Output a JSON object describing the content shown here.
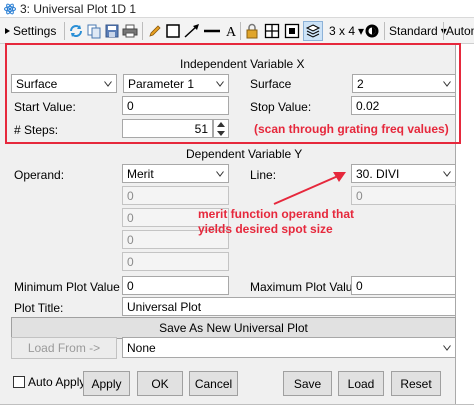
{
  "window": {
    "title": "3: Universal Plot 1D 1"
  },
  "toolbar": {
    "settings_label": "Settings",
    "layout_label": "3 x 4",
    "layout_arrow": "▾",
    "standard_label": "Standard",
    "standard_arrow": "▾",
    "auto_label": "Autom",
    "icons": [
      "refresh-icon",
      "copy-icon",
      "save-file-icon",
      "print-icon",
      "pencil-icon",
      "rectangle-icon",
      "arrow-line-icon",
      "line-icon",
      "text-a-icon",
      "lock-icon",
      "grid-layout-icon",
      "layers-icon",
      "contrast-icon"
    ]
  },
  "independent": {
    "header": "Independent Variable X",
    "surface_combo": "Surface",
    "parameter_combo": "Parameter 1",
    "surface_label": "Surface",
    "surface_value": "2",
    "start_label": "Start Value:",
    "start_value": "0",
    "stop_label": "Stop Value:",
    "stop_value": "0.02",
    "steps_label": "# Steps:",
    "steps_value": "51"
  },
  "dependent": {
    "header": "Dependent Variable Y",
    "operand_label": "Operand:",
    "operand_value": "Merit",
    "line_label": "Line:",
    "line_value": "30. DIVI",
    "params": [
      "0",
      "0",
      "0",
      "0",
      "0"
    ],
    "min_label": "Minimum Plot Value",
    "min_value": "0",
    "max_label": "Maximum Plot Value",
    "max_value": "0"
  },
  "plot": {
    "title_label": "Plot Title:",
    "title_value": "Universal Plot",
    "save_new_label": "Save As New Universal Plot",
    "load_from_label": "Load From ->",
    "load_combo_value": "None"
  },
  "actions": {
    "auto_apply_label": "Auto Apply",
    "apply_label": "Apply",
    "ok_label": "OK",
    "cancel_label": "Cancel",
    "save_label": "Save",
    "load_label": "Load",
    "reset_label": "Reset"
  },
  "annotations": {
    "scan_note": "(scan through grating freq values)",
    "merit_note_line1": "merit function operand that",
    "merit_note_line2": "yields desired spot size"
  },
  "colors": {
    "annotation_red": "#e6283c",
    "toolbar_bg": "#f3f3f3",
    "panel_bg": "#f0f0f0"
  }
}
